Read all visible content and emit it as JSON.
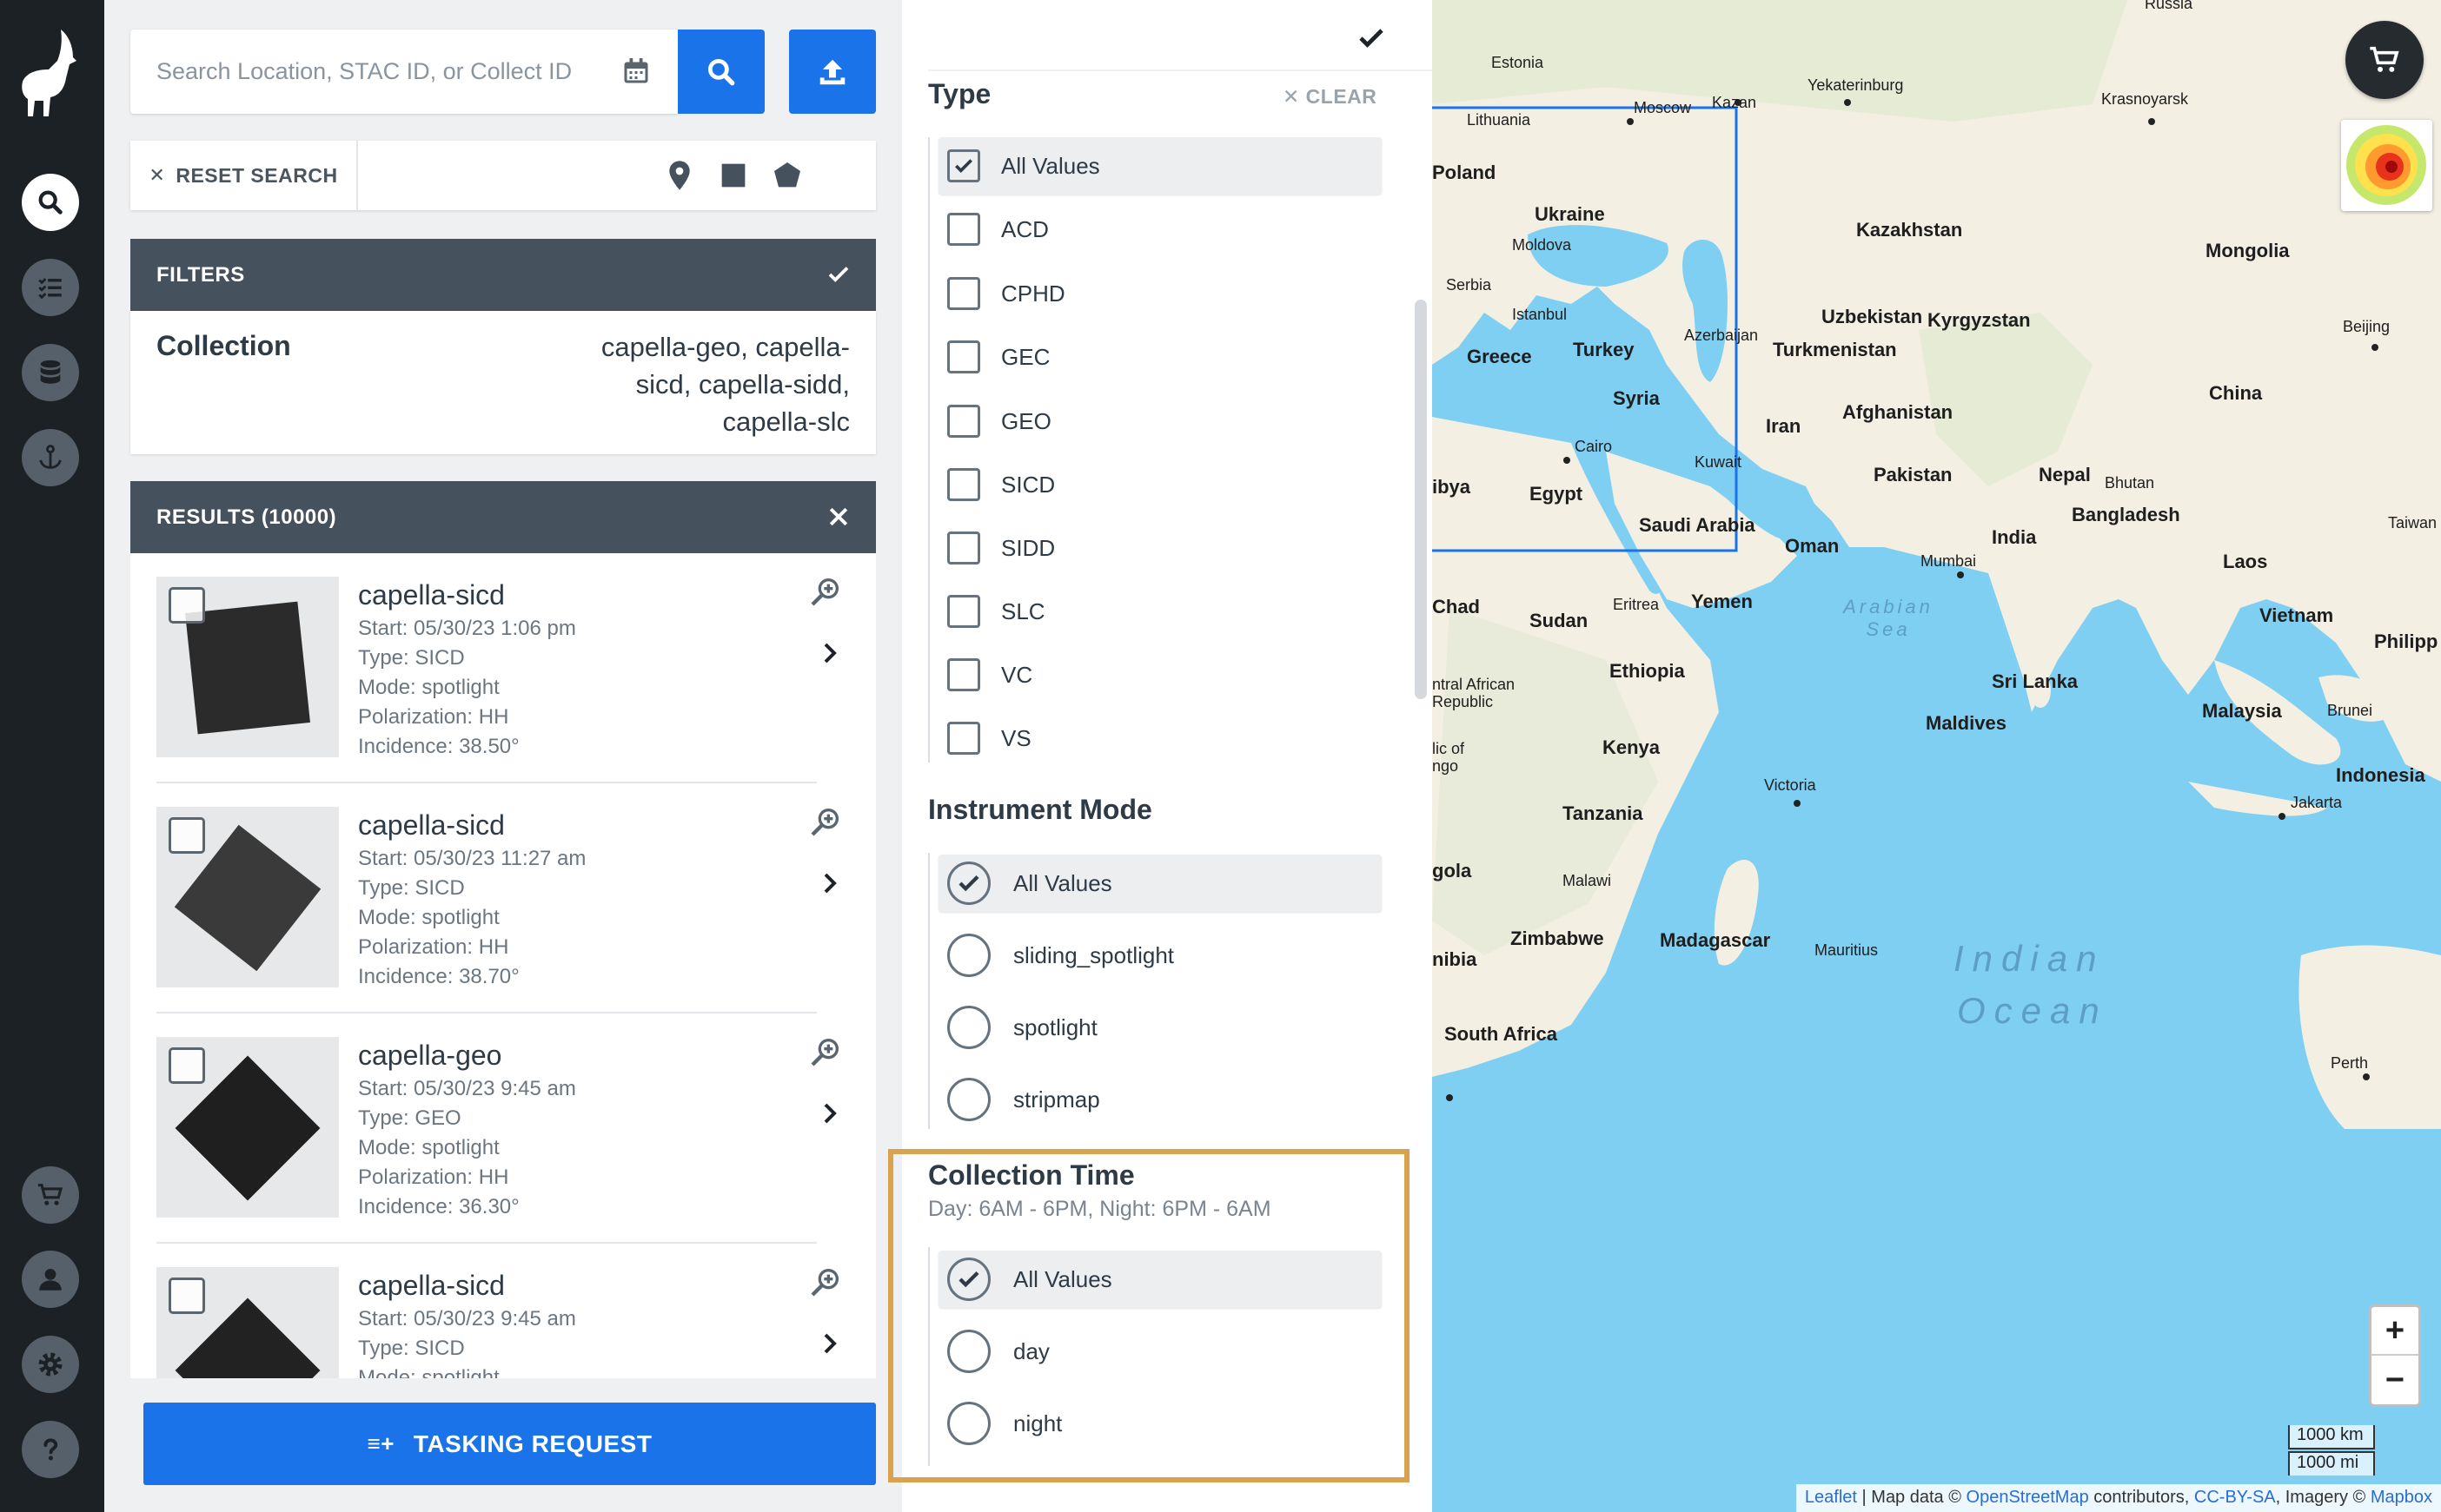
{
  "search": {
    "placeholder": "Search Location, STAC ID, or Collect ID",
    "reset_label": "RESET SEARCH"
  },
  "filters": {
    "header": "FILTERS",
    "collection_label": "Collection",
    "collection_value": "capella-geo, capella-sicd, capella-sidd, capella-slc"
  },
  "results": {
    "header": "RESULTS (10000)",
    "items": [
      {
        "title": "capella-sicd",
        "start": "Start: 05/30/23 1:06 pm",
        "type": "Type: SICD",
        "mode": "Mode: spotlight",
        "polarization": "Polarization: HH",
        "incidence": "Incidence: 38.50°"
      },
      {
        "title": "capella-sicd",
        "start": "Start: 05/30/23 11:27 am",
        "type": "Type: SICD",
        "mode": "Mode: spotlight",
        "polarization": "Polarization: HH",
        "incidence": "Incidence: 38.70°"
      },
      {
        "title": "capella-geo",
        "start": "Start: 05/30/23 9:45 am",
        "type": "Type: GEO",
        "mode": "Mode: spotlight",
        "polarization": "Polarization: HH",
        "incidence": "Incidence: 36.30°"
      },
      {
        "title": "capella-sicd",
        "start": "Start: 05/30/23 9:45 am",
        "type": "Type: SICD",
        "mode": "Mode: spotlight",
        "polarization": "",
        "incidence": ""
      }
    ]
  },
  "tasking_label": "TASKING REQUEST",
  "type_filter": {
    "title": "Type",
    "clear_label": "CLEAR",
    "options": [
      "All Values",
      "ACD",
      "CPHD",
      "GEC",
      "GEO",
      "SICD",
      "SIDD",
      "SLC",
      "VC",
      "VS"
    ]
  },
  "instrument_mode": {
    "title": "Instrument Mode",
    "options": [
      "All Values",
      "sliding_spotlight",
      "spotlight",
      "stripmap"
    ]
  },
  "collection_time": {
    "title": "Collection Time",
    "subtitle": "Day: 6AM - 6PM, Night: 6PM - 6AM",
    "options": [
      "All Values",
      "day",
      "night"
    ]
  },
  "map": {
    "labels": {
      "russia": "Russia",
      "estonia": "Estonia",
      "lithuania": "Lithuania",
      "moscow": "Moscow",
      "kazan": "Kazan",
      "yekaterinburg": "Yekaterinburg",
      "krasnoyarsk": "Krasnoyarsk",
      "poland": "Poland",
      "ukraine": "Ukraine",
      "moldova": "Moldova",
      "kazakhstan": "Kazakhstan",
      "mongolia": "Mongolia",
      "serbia": "Serbia",
      "istanbul": "Istanbul",
      "uzbekistan": "Uzbekistan",
      "kyrgyzstan": "Kyrgyzstan",
      "beijing": "Beijing",
      "greece": "Greece",
      "turkey": "Turkey",
      "azerbaijan": "Azerbaijan",
      "turkmenistan": "Turkmenistan",
      "syria": "Syria",
      "china": "China",
      "iran": "Iran",
      "afghanistan": "Afghanistan",
      "cairo": "Cairo",
      "kuwait": "Kuwait",
      "libya": "ibya",
      "egypt": "Egypt",
      "pakistan": "Pakistan",
      "nepal": "Nepal",
      "bhutan": "Bhutan",
      "bangladesh": "Bangladesh",
      "saudi": "Saudi Arabia",
      "oman": "Oman",
      "india": "India",
      "mumbai": "Mumbai",
      "laos": "Laos",
      "chad": "Chad",
      "sudan": "Sudan",
      "eritrea": "Eritrea",
      "yemen": "Yemen",
      "arabian_sea": "Arabian Sea",
      "vietnam": "Vietnam",
      "philippines": "Philipp",
      "taiwan": "Taiwan",
      "car": "ntral African Republic",
      "ethiopia": "Ethiopia",
      "srilanka": "Sri Lanka",
      "maldives": "Maldives",
      "malaysia": "Malaysia",
      "brunei": "Brunei",
      "congo": "lic of ngo",
      "kenya": "Kenya",
      "indonesia": "Indonesia",
      "victoria": "Victoria",
      "jakarta": "Jakarta",
      "tanzania": "Tanzania",
      "angola": "gola",
      "malawi": "Malawi",
      "zimbabwe": "Zimbabwe",
      "madagascar": "Madagascar",
      "mauritius": "Mauritius",
      "namibia": "nibia",
      "indian_ocean_1": "Indian",
      "indian_ocean_2": "Ocean",
      "south_africa": "South Africa",
      "perth": "Perth"
    },
    "zoom_in": "+",
    "zoom_out": "−",
    "scale_km": "1000 km",
    "scale_mi": "1000 mi",
    "attribution": {
      "leaflet": "Leaflet",
      "sep": " | Map data © ",
      "osm": "OpenStreetMap",
      "mid": " contributors, ",
      "ccbysa": "CC-BY-SA",
      "imagery": ", Imagery © ",
      "mapbox": "Mapbox"
    }
  },
  "colors": {
    "primary": "#1a73e8",
    "panel_header": "#45515c",
    "highlight": "#d9a24f",
    "rail": "#1c2126"
  }
}
